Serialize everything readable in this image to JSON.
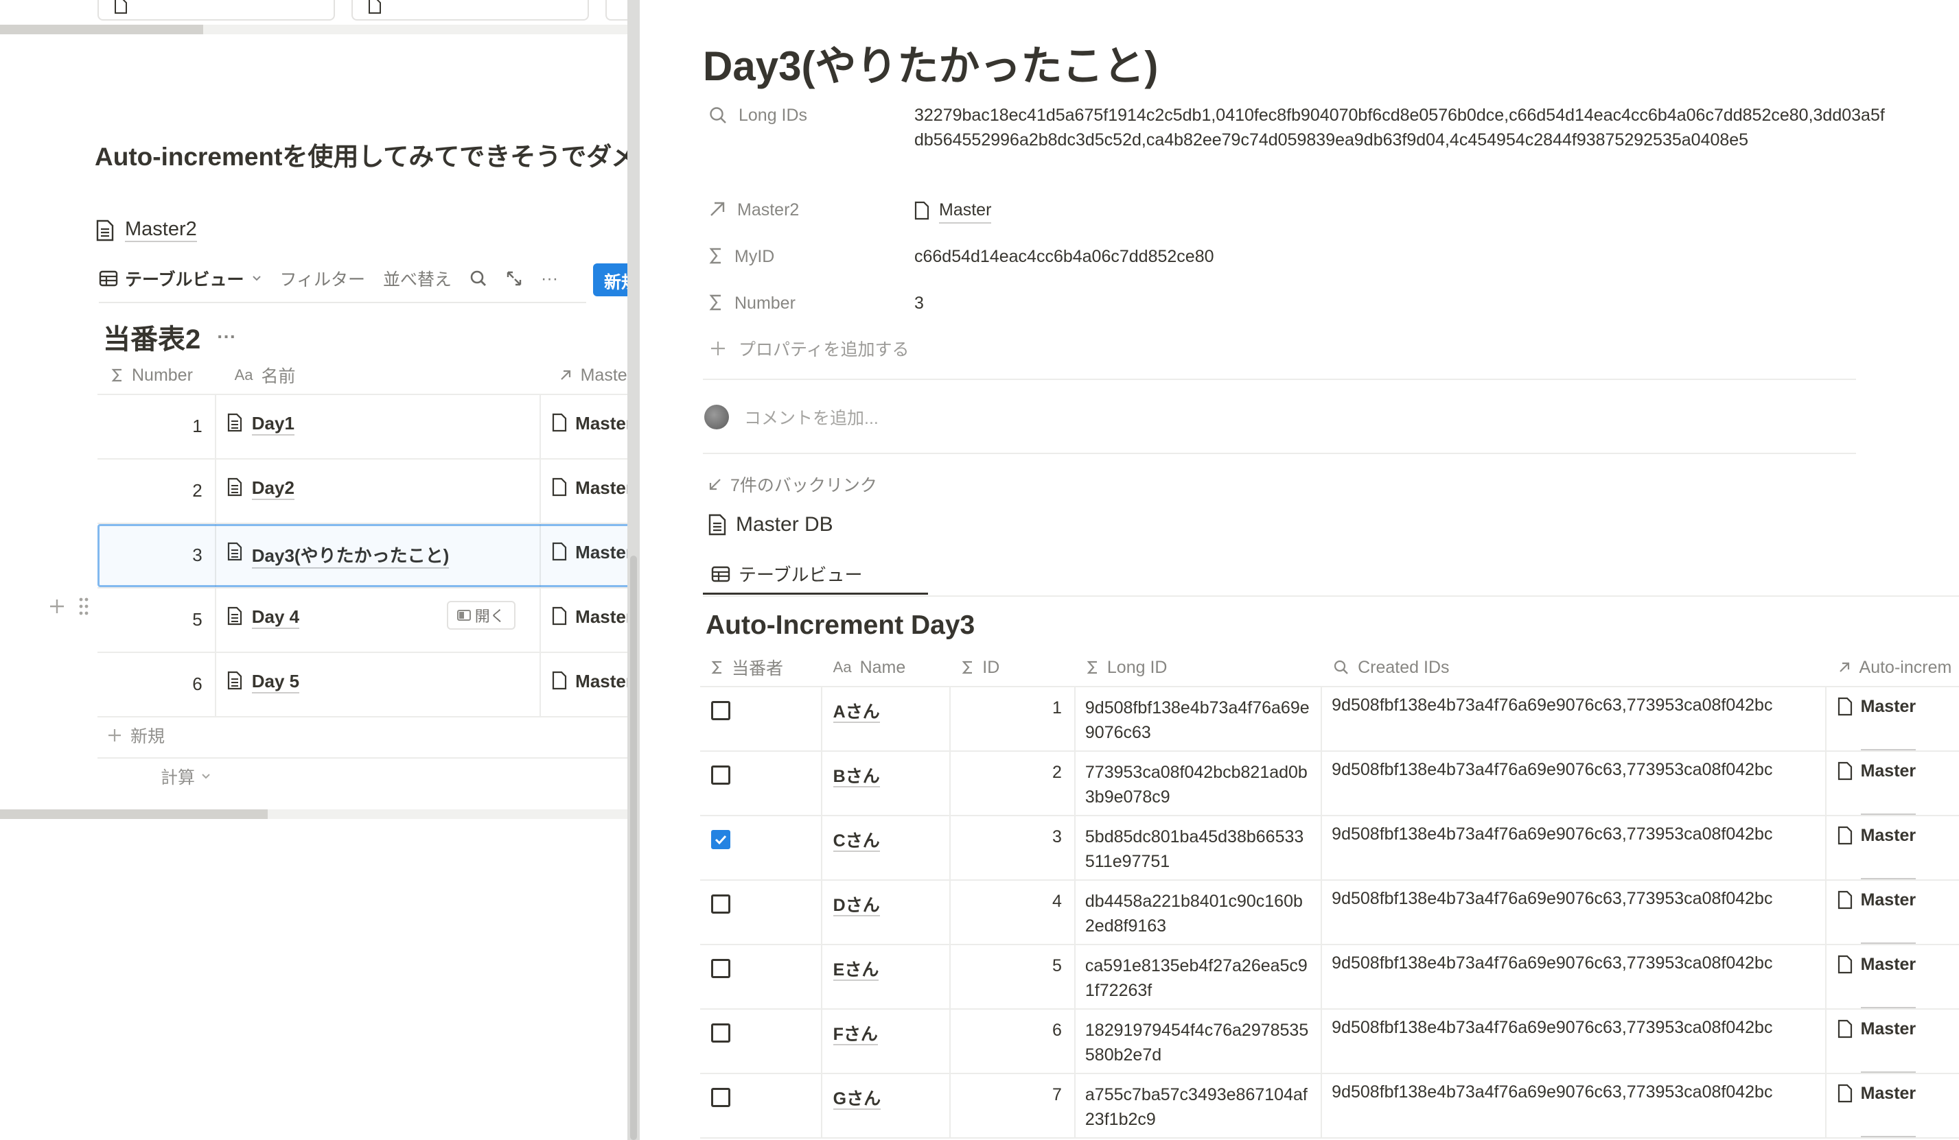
{
  "left": {
    "callout_text": "Auto-incrementを使用してみてできそうでダメだった",
    "linked_page": "Master2",
    "toolbar": {
      "view_label": "テーブルビュー",
      "filter_label": "フィルター",
      "sort_label": "並べ替え",
      "more_label": "···",
      "new_label": "新規"
    },
    "db_title": "当番表2",
    "db_title_more": "···",
    "columns": {
      "number": "Number",
      "name": "名前",
      "master": "Master"
    },
    "rows": [
      {
        "number": "1",
        "name": "Day1",
        "master": "Master"
      },
      {
        "number": "2",
        "name": "Day2",
        "master": "Master"
      },
      {
        "number": "3",
        "name": "Day3(やりたかったこと)",
        "master": "Master"
      },
      {
        "number": "5",
        "name": "Day 4",
        "master": "Master"
      },
      {
        "number": "6",
        "name": "Day 5",
        "master": "Master"
      }
    ],
    "open_button": "開く",
    "new_row_label": "新規",
    "calc_label": "計算"
  },
  "peek": {
    "title": "Day3(やりたかったこと)",
    "properties": [
      {
        "name": "Long IDs",
        "icon": "search-icon",
        "value": "32279bac18ec41d5a675f1914c2c5db1,0410fec8fb904070bf6cd8e0576b0dce,c66d54d14eac4cc6b4a06c7dd852ce80,3dd03a5fdb564552996a2b8dc3d5c52d,ca4b82ee79c74d059839ea9db63f9d04,4c454954c2844f93875292535a0408e5"
      },
      {
        "name": "Master2",
        "icon": "relation-arrow-icon",
        "value": "Master"
      },
      {
        "name": "MyID",
        "icon": "sigma-icon",
        "value": "c66d54d14eac4cc6b4a06c7dd852ce80"
      },
      {
        "name": "Number",
        "icon": "sigma-icon",
        "value": "3"
      }
    ],
    "add_property": "プロパティを追加する",
    "comment_placeholder": "コメントを追加...",
    "backlinks": "7件のバックリンク",
    "linked_db": "Master DB",
    "view_tab": "テーブルビュー",
    "db_title": "Auto-Increment Day3",
    "columns": {
      "assignee": "当番者",
      "name": "Name",
      "id": "ID",
      "long_id": "Long ID",
      "created_ids": "Created IDs",
      "relation": "Auto-increm"
    },
    "rows": [
      {
        "checked": false,
        "name": "Aさん",
        "id": "1",
        "long_id": "9d508fbf138e4b73a4f76a69e9076c63",
        "created_ids": "9d508fbf138e4b73a4f76a69e9076c63,773953ca08f042bc",
        "relation": "Master"
      },
      {
        "checked": false,
        "name": "Bさん",
        "id": "2",
        "long_id": "773953ca08f042bcb821ad0b3b9e078c9",
        "created_ids": "9d508fbf138e4b73a4f76a69e9076c63,773953ca08f042bc",
        "relation": "Master"
      },
      {
        "checked": true,
        "name": "Cさん",
        "id": "3",
        "long_id": "5bd85dc801ba45d38b66533511e97751",
        "created_ids": "9d508fbf138e4b73a4f76a69e9076c63,773953ca08f042bc",
        "relation": "Master"
      },
      {
        "checked": false,
        "name": "Dさん",
        "id": "4",
        "long_id": "db4458a221b8401c90c160b2ed8f9163",
        "created_ids": "9d508fbf138e4b73a4f76a69e9076c63,773953ca08f042bc",
        "relation": "Master"
      },
      {
        "checked": false,
        "name": "Eさん",
        "id": "5",
        "long_id": "ca591e8135eb4f27a26ea5c91f72263f",
        "created_ids": "9d508fbf138e4b73a4f76a69e9076c63,773953ca08f042bc",
        "relation": "Master"
      },
      {
        "checked": false,
        "name": "Fさん",
        "id": "6",
        "long_id": "18291979454f4c76a2978535580b2e7d",
        "created_ids": "9d508fbf138e4b73a4f76a69e9076c63,773953ca08f042bc",
        "relation": "Master"
      },
      {
        "checked": false,
        "name": "Gさん",
        "id": "7",
        "long_id": "a755c7ba57c3493e867104af23f1b2c9",
        "created_ids": "9d508fbf138e4b73a4f76a69e9076c63,773953ca08f042bc",
        "relation": "Master"
      }
    ]
  },
  "colors": {
    "accent": "#2383e2",
    "text": "#37352f",
    "border": "#ececea"
  }
}
